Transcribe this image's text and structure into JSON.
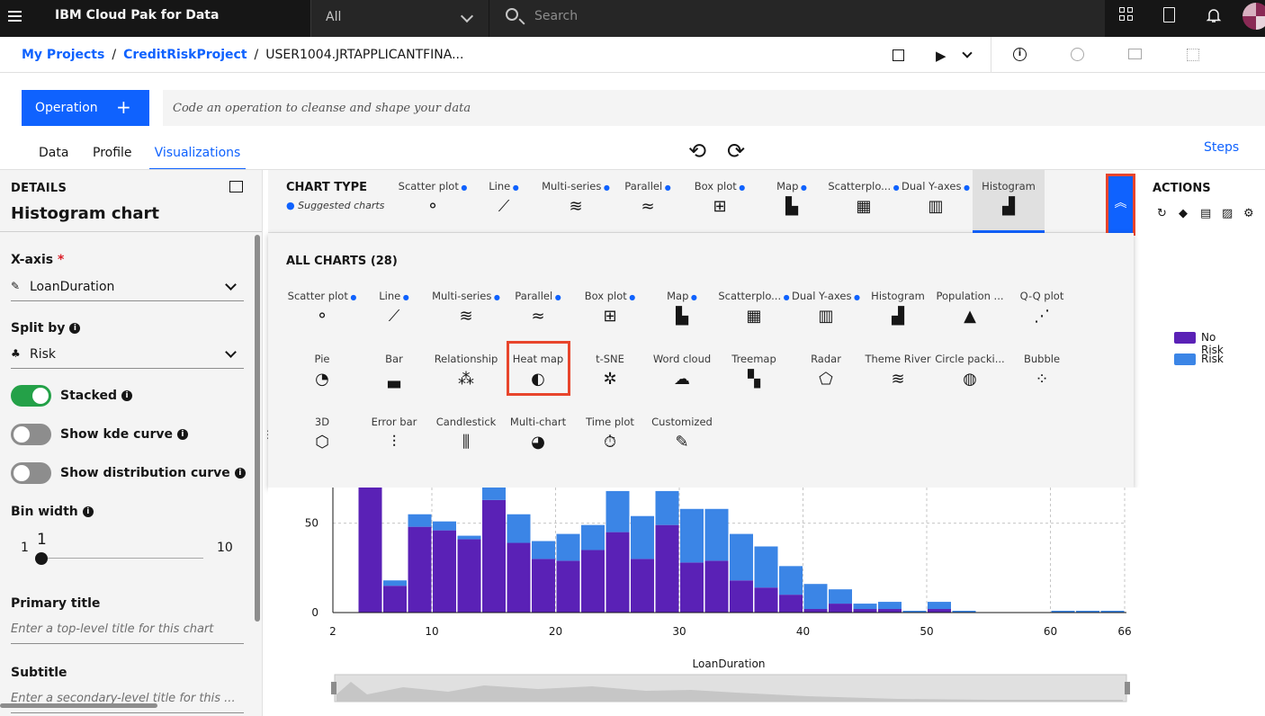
{
  "app": {
    "title": "IBM Cloud Pak for Data",
    "scope": "All",
    "search_placeholder": "Search"
  },
  "breadcrumb": {
    "items": [
      "My Projects",
      "CreditRiskProject"
    ],
    "current": "USER1004.JRTAPPLICANTFINA..."
  },
  "operation": {
    "button_label": "Operation",
    "placeholder": "Code an operation to cleanse and shape your data"
  },
  "tabs": {
    "data": "Data",
    "profile": "Profile",
    "visualizations": "Visualizations",
    "active": "Visualizations"
  },
  "steps_label": "Steps",
  "details": {
    "header": "DETAILS",
    "chart_name": "Histogram chart",
    "x_axis_label": "X-axis",
    "x_axis_required": "*",
    "x_axis_value": "LoanDuration",
    "split_by_label": "Split by",
    "split_by_value": "Risk",
    "stacked_label": "Stacked",
    "stacked_on": true,
    "kde_label": "Show kde curve",
    "kde_on": false,
    "distribution_label": "Show distribution curve",
    "distribution_on": false,
    "bin_width_label": "Bin width",
    "bin_min": "1",
    "bin_max": "10",
    "bin_value": "1",
    "primary_title_label": "Primary title",
    "primary_title_placeholder": "Enter a top-level title for this chart",
    "subtitle_label": "Subtitle",
    "subtitle_placeholder": "Enter a secondary-level title for this ..."
  },
  "chart_type": {
    "title": "CHART TYPE",
    "subtitle": "Suggested charts",
    "suggested": [
      {
        "label": "Scatter plot",
        "icon": "scatter-icon",
        "glyph": "⚬",
        "dot": true
      },
      {
        "label": "Line",
        "icon": "line-chart-icon",
        "glyph": "⟋",
        "dot": true
      },
      {
        "label": "Multi-series",
        "icon": "multi-series-icon",
        "glyph": "≋",
        "dot": true
      },
      {
        "label": "Parallel",
        "icon": "parallel-icon",
        "glyph": "≈",
        "dot": true
      },
      {
        "label": "Box plot",
        "icon": "box-plot-icon",
        "glyph": "⊞",
        "dot": true
      },
      {
        "label": "Map",
        "icon": "map-icon",
        "glyph": "▙",
        "dot": true
      },
      {
        "label": "Scatterplo...",
        "icon": "scatter-matrix-icon",
        "glyph": "▦",
        "dot": true
      },
      {
        "label": "Dual Y-axes",
        "icon": "dual-y-axes-icon",
        "glyph": "▥",
        "dot": true
      },
      {
        "label": "Histogram",
        "icon": "histogram-icon",
        "glyph": "▟",
        "dot": false,
        "selected": true
      }
    ]
  },
  "actions": {
    "title": "ACTIONS",
    "icons": [
      "refresh-icon",
      "tag-icon",
      "code-file-icon",
      "image-icon",
      "settings-icon"
    ],
    "glyphs": [
      "↻",
      "◆",
      "▤",
      "▨",
      "⚙"
    ]
  },
  "all_charts": {
    "title": "ALL CHARTS (28)",
    "items": [
      {
        "label": "Scatter plot",
        "dot": true,
        "icon": "scatter-icon",
        "glyph": "⚬"
      },
      {
        "label": "Line",
        "dot": true,
        "icon": "line-chart-icon",
        "glyph": "⟋"
      },
      {
        "label": "Multi-series",
        "dot": true,
        "icon": "multi-series-icon",
        "glyph": "≋"
      },
      {
        "label": "Parallel",
        "dot": true,
        "icon": "parallel-icon",
        "glyph": "≈"
      },
      {
        "label": "Box plot",
        "dot": true,
        "icon": "box-plot-icon",
        "glyph": "⊞"
      },
      {
        "label": "Map",
        "dot": true,
        "icon": "map-icon",
        "glyph": "▙"
      },
      {
        "label": "Scatterplo...",
        "dot": true,
        "icon": "scatter-matrix-icon",
        "glyph": "▦"
      },
      {
        "label": "Dual Y-axes",
        "dot": true,
        "icon": "dual-y-axes-icon",
        "glyph": "▥"
      },
      {
        "label": "Histogram",
        "dot": false,
        "icon": "histogram-icon",
        "glyph": "▟"
      },
      {
        "label": "Population ...",
        "dot": false,
        "icon": "population-pyramid-icon",
        "glyph": "▲"
      },
      {
        "label": "Q-Q plot",
        "dot": false,
        "icon": "qq-plot-icon",
        "glyph": "⋰"
      },
      {
        "label": "Pie",
        "dot": false,
        "icon": "pie-icon",
        "glyph": "◔"
      },
      {
        "label": "Bar",
        "dot": false,
        "icon": "bar-icon",
        "glyph": "▃"
      },
      {
        "label": "Relationship",
        "dot": false,
        "icon": "relationship-icon",
        "glyph": "⁂"
      },
      {
        "label": "Heat map",
        "dot": false,
        "icon": "heat-map-icon",
        "glyph": "◐"
      },
      {
        "label": "t-SNE",
        "dot": false,
        "icon": "tsne-icon",
        "glyph": "✲"
      },
      {
        "label": "Word cloud",
        "dot": false,
        "icon": "word-cloud-icon",
        "glyph": "☁"
      },
      {
        "label": "Treemap",
        "dot": false,
        "icon": "treemap-icon",
        "glyph": "▚"
      },
      {
        "label": "Radar",
        "dot": false,
        "icon": "radar-icon",
        "glyph": "⬠"
      },
      {
        "label": "Theme River",
        "dot": false,
        "icon": "theme-river-icon",
        "glyph": "≋"
      },
      {
        "label": "Circle packi...",
        "dot": false,
        "icon": "circle-packing-icon",
        "glyph": "◍"
      },
      {
        "label": "Bubble",
        "dot": false,
        "icon": "bubble-icon",
        "glyph": "⁘"
      },
      {
        "label": "3D",
        "dot": false,
        "icon": "3d-cubes-icon",
        "glyph": "⬡"
      },
      {
        "label": "Error bar",
        "dot": false,
        "icon": "error-bar-icon",
        "glyph": "⫶"
      },
      {
        "label": "Candlestick",
        "dot": false,
        "icon": "candlestick-icon",
        "glyph": "⫼"
      },
      {
        "label": "Multi-chart",
        "dot": false,
        "icon": "multi-chart-icon",
        "glyph": "◕"
      },
      {
        "label": "Time plot",
        "dot": false,
        "icon": "time-plot-icon",
        "glyph": "⏱"
      },
      {
        "label": "Customized",
        "dot": false,
        "icon": "customized-icon",
        "glyph": "✎"
      }
    ]
  },
  "colors": {
    "accent": "#0f62fe",
    "no_risk": "#5a21b6",
    "risk": "#3b85e6",
    "highlight": "#e8452c",
    "toggle_on": "#24a148"
  },
  "chart_data": {
    "type": "bar",
    "xlabel": "LoanDuration",
    "x_ticks": [
      2,
      10,
      20,
      30,
      40,
      50,
      60,
      66
    ],
    "y_ticks": [
      0,
      50
    ],
    "xlim": [
      2,
      66
    ],
    "ylim": [
      0,
      75
    ],
    "bin_width": 2,
    "bin_starts": [
      4,
      6,
      8,
      10,
      12,
      14,
      16,
      18,
      20,
      22,
      24,
      26,
      28,
      30,
      32,
      34,
      36,
      38,
      40,
      42,
      44,
      46,
      48,
      50,
      52,
      60,
      62,
      64
    ],
    "series": [
      {
        "name": "No Risk",
        "values": [
          75,
          15,
          48,
          46,
          41,
          63,
          39,
          30,
          29,
          35,
          45,
          30,
          49,
          28,
          29,
          18,
          14,
          10,
          2,
          5,
          2,
          2,
          0,
          2,
          0,
          0,
          0,
          0
        ]
      },
      {
        "name": "Risk",
        "values": [
          0,
          3,
          7,
          5,
          2,
          12,
          16,
          10,
          15,
          14,
          23,
          24,
          19,
          30,
          29,
          26,
          23,
          16,
          14,
          8,
          3,
          4,
          1,
          4,
          1,
          1,
          1,
          1
        ]
      }
    ],
    "legend_position": "right"
  }
}
